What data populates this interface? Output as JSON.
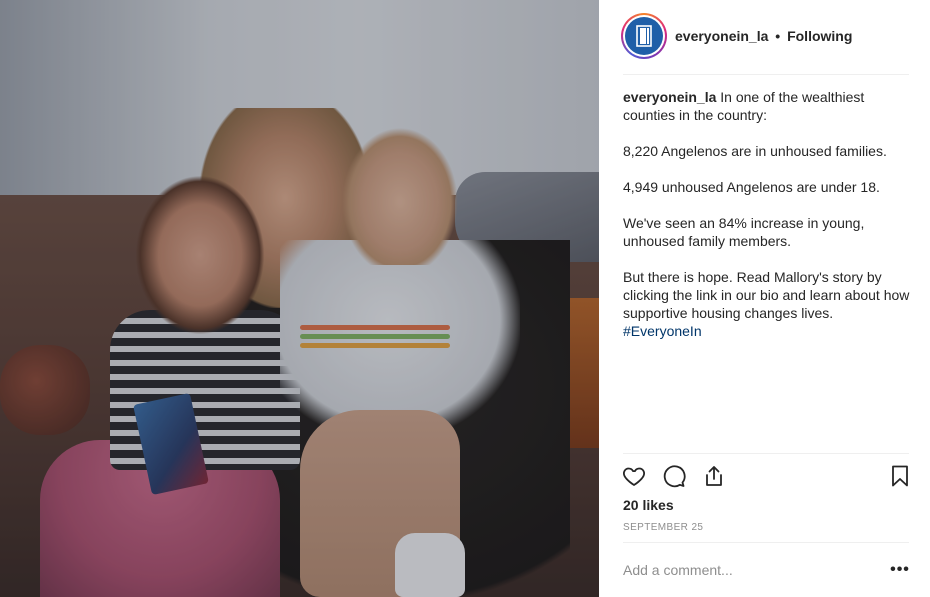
{
  "post": {
    "username": "everyonein_la",
    "separator": "•",
    "follow_status": "Following",
    "caption": {
      "username": "everyonein_la",
      "line1": "In one of the wealthiest counties in the country:",
      "para2": "8,220 Angelenos are in unhoused families.",
      "para3": "4,949 unhoused Angelenos are under 18.",
      "para4": "We've seen an 84% increase in young, unhoused family members.",
      "para5": "But there is hope. Read Mallory's story by clicking the link in our bio and learn about how supportive housing changes lives.",
      "hashtag": "#EveryoneIn"
    },
    "likes": "20 likes",
    "date": "SEPTEMBER 25"
  },
  "comment": {
    "placeholder": "Add a comment..."
  },
  "more_label": "•••",
  "icons": {
    "like": "heart-icon",
    "comment": "comment-icon",
    "share": "share-icon",
    "save": "bookmark-icon",
    "more": "more-options-icon",
    "avatar": "door-logo-icon"
  },
  "colors": {
    "hashtag": "#003569",
    "avatar_bg": "#1f5fa8",
    "muted_text": "#8e8e8e"
  }
}
